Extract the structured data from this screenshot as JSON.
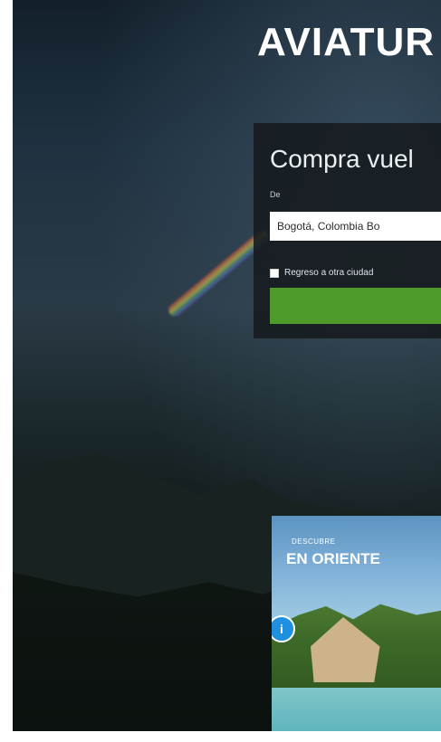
{
  "brand": {
    "logo_text": "AVIATUR"
  },
  "search": {
    "title": "Compra vuel",
    "origin_label": "De",
    "origin_value": "Bogotá, Colombia Bo",
    "return_label": "Regreso a otra ciudad",
    "button_label": ""
  },
  "promo": {
    "subtitle": "DESCUBRE",
    "title": "EN ORIENTE",
    "badge": "i"
  },
  "colors": {
    "search_button": "#4e9a2b",
    "panel_bg": "#16191e",
    "badge": "#1f8fe0"
  }
}
